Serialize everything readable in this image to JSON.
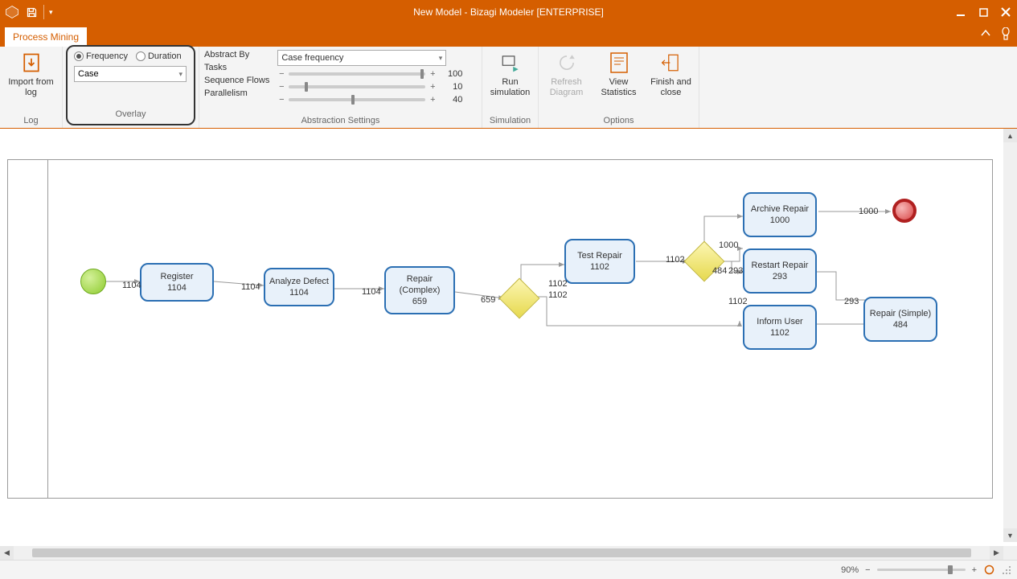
{
  "title": "New Model - Bizagi Modeler [ENTERPRISE]",
  "tab": "Process Mining",
  "ribbon": {
    "log": {
      "import_label": "Import from log",
      "group": "Log"
    },
    "overlay": {
      "freq": "Frequency",
      "dur": "Duration",
      "combo": "Case",
      "group": "Overlay"
    },
    "abstraction": {
      "abstract_by": "Abstract By",
      "abstract_by_val": "Case frequency",
      "tasks": "Tasks",
      "tasks_val": "100",
      "seq": "Sequence Flows",
      "seq_val": "10",
      "par": "Parallelism",
      "par_val": "40",
      "group": "Abstraction Settings"
    },
    "simulation": {
      "run": "Run simulation",
      "group": "Simulation"
    },
    "options": {
      "refresh": "Refresh Diagram",
      "view": "View Statistics",
      "finish": "Finish and close",
      "group": "Options"
    }
  },
  "diagram": {
    "tasks": {
      "register": {
        "name": "Register",
        "val": "1104"
      },
      "analyze": {
        "name": "Analyze Defect",
        "val": "1104"
      },
      "repair_complex": {
        "name": "Repair (Complex)",
        "val": "659"
      },
      "test_repair": {
        "name": "Test Repair",
        "val": "1102"
      },
      "archive": {
        "name": "Archive Repair",
        "val": "1000"
      },
      "restart": {
        "name": "Restart Repair",
        "val": "293"
      },
      "inform": {
        "name": "Inform User",
        "val": "1102"
      },
      "repair_simple": {
        "name": "Repair (Simple)",
        "val": "484"
      }
    },
    "labels": {
      "l1": "1104",
      "l2": "1104",
      "l3": "1104",
      "l4": "659",
      "l5a": "1102",
      "l5b": "1102",
      "l6": "1102",
      "l7": "484",
      "l8": "293",
      "l9": "1000",
      "l10": "1000",
      "l11": "1102",
      "l12": "293"
    }
  },
  "status": {
    "zoom": "90%"
  }
}
